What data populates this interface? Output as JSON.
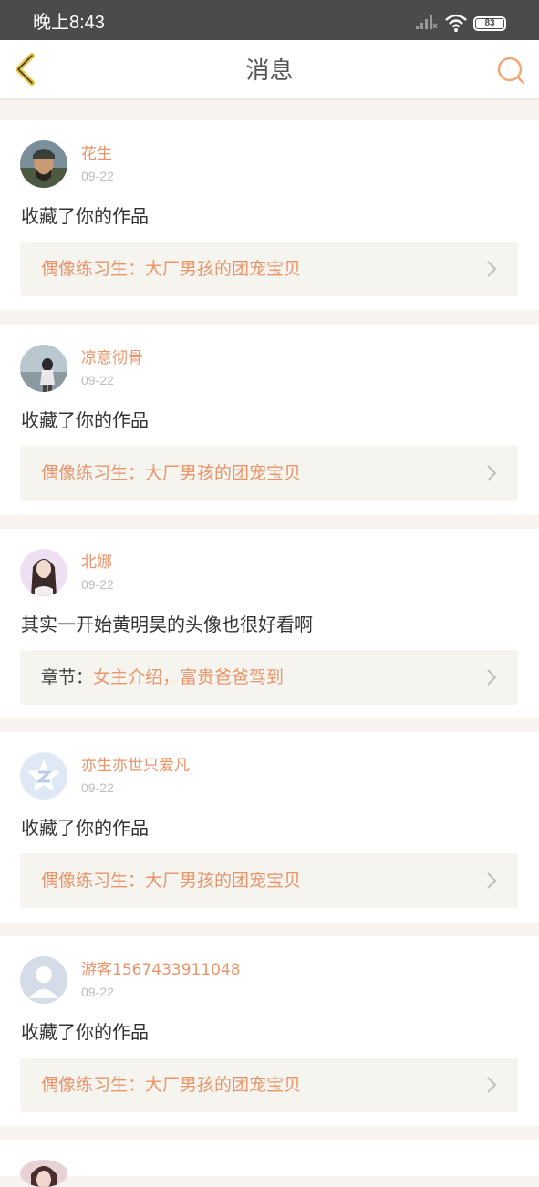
{
  "status_bar": {
    "time": "晚上8:43",
    "battery": "83"
  },
  "header": {
    "title": "消息"
  },
  "colors": {
    "accent": "#e8956b",
    "back_icon": "#e8c440",
    "ref_background": "#f5f4ee"
  },
  "icons": [
    "back-arrow-icon",
    "search-icon",
    "signal-icon",
    "wifi-icon",
    "battery-icon",
    "chevron-right-icon"
  ],
  "messages": [
    {
      "user": "花生",
      "date": "09-22",
      "text": "收藏了你的作品",
      "ref_prefix": "",
      "ref_title": "偶像练习生：大厂男孩的团宠宝贝"
    },
    {
      "user": "凉意彻骨",
      "date": "09-22",
      "text": "收藏了你的作品",
      "ref_prefix": "",
      "ref_title": "偶像练习生：大厂男孩的团宠宝贝"
    },
    {
      "user": "北娜",
      "date": "09-22",
      "text": "其实一开始黄明昊的头像也很好看啊",
      "ref_prefix": "章节：",
      "ref_title": "女主介绍，富贵爸爸驾到"
    },
    {
      "user": "亦生亦世只爱凡",
      "date": "09-22",
      "text": "收藏了你的作品",
      "ref_prefix": "",
      "ref_title": "偶像练习生：大厂男孩的团宠宝贝"
    },
    {
      "user": "游客1567433911048",
      "date": "09-22",
      "text": "收藏了你的作品",
      "ref_prefix": "",
      "ref_title": "偶像练习生：大厂男孩的团宠宝贝"
    }
  ]
}
